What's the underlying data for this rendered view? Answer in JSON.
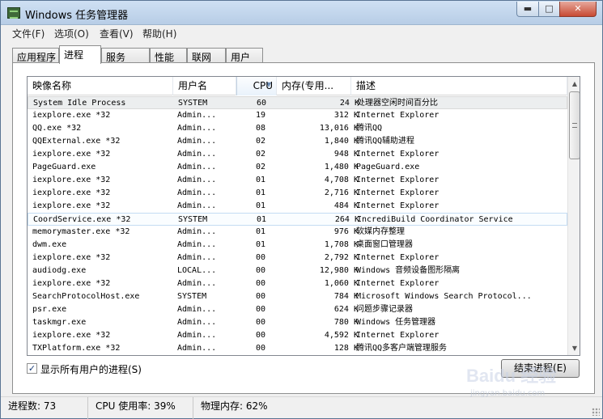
{
  "window": {
    "title": "Windows 任务管理器",
    "min_glyph": "▬",
    "max_glyph": "□",
    "close_glyph": "✕"
  },
  "menu": [
    "文件(F)",
    "选项(O)",
    "查看(V)",
    "帮助(H)"
  ],
  "tabs": [
    {
      "label": "应用程序",
      "active": false
    },
    {
      "label": "进程",
      "active": true
    },
    {
      "label": "服务",
      "active": false
    },
    {
      "label": "性能",
      "active": false
    },
    {
      "label": "联网",
      "active": false
    },
    {
      "label": "用户",
      "active": false
    }
  ],
  "columns": {
    "name": "映像名称",
    "user": "用户名",
    "cpu": "CPU",
    "mem": "内存(专用...",
    "desc": "描述",
    "sort_arrow": "▼"
  },
  "processes": [
    {
      "name": "System Idle Process",
      "user": "SYSTEM",
      "cpu": "60",
      "mem": "24 K",
      "desc": "处理器空闲时间百分比"
    },
    {
      "name": "iexplore.exe *32",
      "user": "Admin...",
      "cpu": "19",
      "mem": "312 K",
      "desc": "Internet Explorer"
    },
    {
      "name": "QQ.exe *32",
      "user": "Admin...",
      "cpu": "08",
      "mem": "13,016 K",
      "desc": "腾讯QQ"
    },
    {
      "name": "QQExternal.exe *32",
      "user": "Admin...",
      "cpu": "02",
      "mem": "1,840 K",
      "desc": "腾讯QQ辅助进程"
    },
    {
      "name": "iexplore.exe *32",
      "user": "Admin...",
      "cpu": "02",
      "mem": "948 K",
      "desc": "Internet Explorer"
    },
    {
      "name": "PageGuard.exe",
      "user": "Admin...",
      "cpu": "02",
      "mem": "1,480 K",
      "desc": "PageGuard.exe"
    },
    {
      "name": "iexplore.exe *32",
      "user": "Admin...",
      "cpu": "01",
      "mem": "4,708 K",
      "desc": "Internet Explorer"
    },
    {
      "name": "iexplore.exe *32",
      "user": "Admin...",
      "cpu": "01",
      "mem": "2,716 K",
      "desc": "Internet Explorer"
    },
    {
      "name": "iexplore.exe *32",
      "user": "Admin...",
      "cpu": "01",
      "mem": "484 K",
      "desc": "Internet Explorer"
    },
    {
      "name": "CoordService.exe *32",
      "user": "SYSTEM",
      "cpu": "01",
      "mem": "264 K",
      "desc": "IncrediBuild Coordinator Service"
    },
    {
      "name": "memorymaster.exe *32",
      "user": "Admin...",
      "cpu": "01",
      "mem": "976 K",
      "desc": "软媒内存整理"
    },
    {
      "name": "dwm.exe",
      "user": "Admin...",
      "cpu": "01",
      "mem": "1,708 K",
      "desc": "桌面窗口管理器"
    },
    {
      "name": "iexplore.exe *32",
      "user": "Admin...",
      "cpu": "00",
      "mem": "2,792 K",
      "desc": "Internet Explorer"
    },
    {
      "name": "audiodg.exe",
      "user": "LOCAL...",
      "cpu": "00",
      "mem": "12,980 K",
      "desc": "Windows 音频设备图形隔离"
    },
    {
      "name": "iexplore.exe *32",
      "user": "Admin...",
      "cpu": "00",
      "mem": "1,060 K",
      "desc": "Internet Explorer"
    },
    {
      "name": "SearchProtocolHost.exe",
      "user": "SYSTEM",
      "cpu": "00",
      "mem": "784 K",
      "desc": "Microsoft Windows Search Protocol..."
    },
    {
      "name": "psr.exe",
      "user": "Admin...",
      "cpu": "00",
      "mem": "624 K",
      "desc": "问题步骤记录器"
    },
    {
      "name": "taskmgr.exe",
      "user": "Admin...",
      "cpu": "00",
      "mem": "780 K",
      "desc": "Windows 任务管理器"
    },
    {
      "name": "iexplore.exe *32",
      "user": "Admin...",
      "cpu": "00",
      "mem": "4,592 K",
      "desc": "Internet Explorer"
    },
    {
      "name": "TXPlatform.exe *32",
      "user": "Admin...",
      "cpu": "00",
      "mem": "128 K",
      "desc": "腾讯QQ多客户端管理服务"
    }
  ],
  "selected_row": 0,
  "hover_row": 9,
  "show_all_users": {
    "label": "显示所有用户的进程(S)",
    "checked": true,
    "check_glyph": "✓"
  },
  "end_process_label": "结束进程(E)",
  "scrollbar": {
    "up_glyph": "▲",
    "down_glyph": "▼"
  },
  "status": {
    "processes": "进程数: 73",
    "cpu": "CPU 使用率: 39%",
    "memory": "物理内存: 62%"
  },
  "watermark": {
    "main": "Baidu 经验",
    "sub": "jingyan.baidu.com"
  }
}
